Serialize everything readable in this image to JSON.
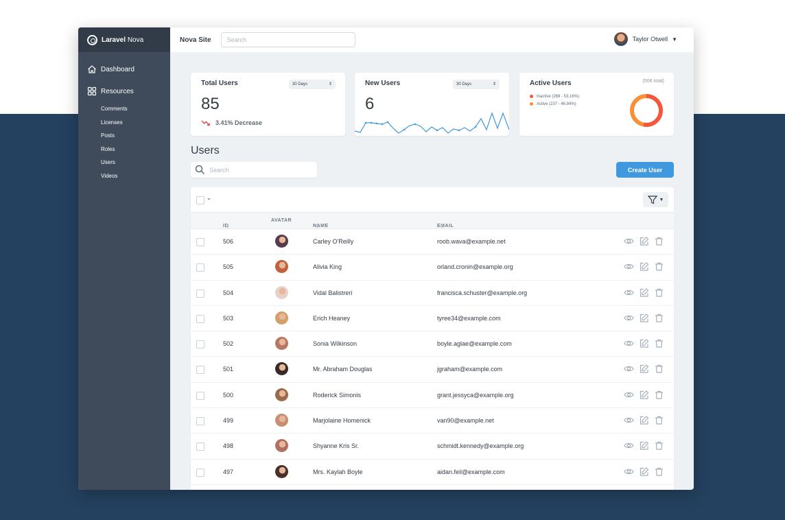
{
  "brand": {
    "name": "Laravel",
    "suffix": "Nova"
  },
  "sidebar": {
    "dashboard": "Dashboard",
    "resources": "Resources",
    "items": [
      "Comments",
      "Licenses",
      "Posts",
      "Roles",
      "Users",
      "Videos"
    ]
  },
  "header": {
    "site_name": "Nova Site",
    "search_placeholder": "Search",
    "user_name": "Taylor Otwell"
  },
  "metrics": {
    "total_users": {
      "title": "Total Users",
      "range": "30 Days",
      "value": "85",
      "trend": "3.41% Decrease",
      "trend_color": "#e74444"
    },
    "new_users": {
      "title": "New Users",
      "range": "30 Days",
      "value": "6"
    },
    "active_users": {
      "title": "Active Users",
      "total": "(506 total)",
      "legend": [
        {
          "label": "Inactive (269 - 53.16%)",
          "color": "#f5573b",
          "fraction": 0.5316
        },
        {
          "label": "Active (237 - 46.84%)",
          "color": "#f99037",
          "fraction": 0.4684
        }
      ]
    }
  },
  "users": {
    "title": "Users",
    "search_placeholder": "Search",
    "create_label": "Create User",
    "columns": {
      "id": "ID",
      "avatar": "AVATAR",
      "name": "NAME",
      "email": "EMAIL"
    },
    "rows": [
      {
        "id": "506",
        "name": "Carley O'Reilly",
        "email": "roob.wava@example.net"
      },
      {
        "id": "505",
        "name": "Alivia King",
        "email": "orland.cronin@example.org"
      },
      {
        "id": "504",
        "name": "Vidal Balistreri",
        "email": "francisca.schuster@example.org"
      },
      {
        "id": "503",
        "name": "Erich Heaney",
        "email": "tyree34@example.com"
      },
      {
        "id": "502",
        "name": "Sonia Wilkinson",
        "email": "boyle.aglae@example.com"
      },
      {
        "id": "501",
        "name": "Mr. Abraham Douglas",
        "email": "jgraham@example.com"
      },
      {
        "id": "500",
        "name": "Roderick Simonis",
        "email": "grant.jessyca@example.org"
      },
      {
        "id": "499",
        "name": "Marjolaine Homenick",
        "email": "van90@example.net"
      },
      {
        "id": "498",
        "name": "Shyanne Kris Sr.",
        "email": "schmidt.kennedy@example.org"
      },
      {
        "id": "497",
        "name": "Mrs. Kaylah Boyle",
        "email": "aidan.feil@example.com"
      }
    ]
  },
  "colors": {
    "accent": "#4099de",
    "sidebar": "#3f4b5a",
    "page_background": "#24415f"
  }
}
